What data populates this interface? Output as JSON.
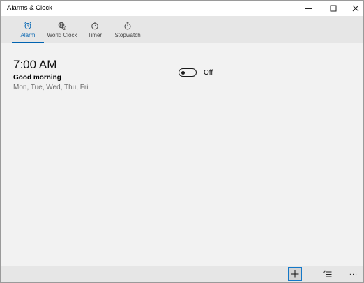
{
  "window": {
    "title": "Alarms & Clock"
  },
  "tabs": [
    {
      "label": "Alarm",
      "icon": "alarm-clock-icon",
      "active": true
    },
    {
      "label": "World Clock",
      "icon": "globe-icon",
      "active": false
    },
    {
      "label": "Timer",
      "icon": "timer-icon",
      "active": false
    },
    {
      "label": "Stopwatch",
      "icon": "stopwatch-icon",
      "active": false
    }
  ],
  "alarms": [
    {
      "time": "7:00 AM",
      "name": "Good morning",
      "days": "Mon, Tue, Wed, Thu, Fri",
      "toggle_label": "Off",
      "enabled": false
    }
  ],
  "commands": {
    "add_icon": "plus-icon",
    "select_icon": "select-list-icon",
    "more_label": "..."
  },
  "colors": {
    "accent": "#0063b1",
    "focus": "#1478c8",
    "background": "#f2f2f2",
    "tabbar": "#e6e6e6"
  }
}
